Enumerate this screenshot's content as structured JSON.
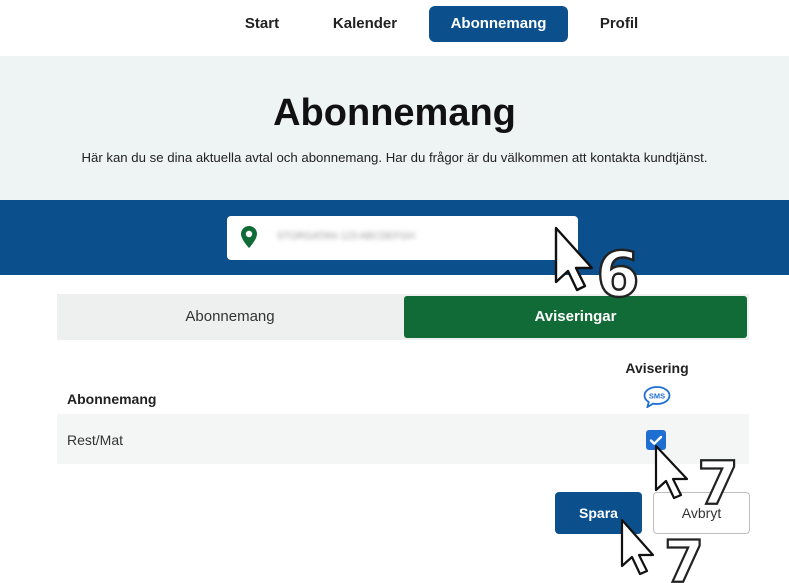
{
  "nav": {
    "items": [
      {
        "label": "Start"
      },
      {
        "label": "Kalender"
      },
      {
        "label": "Abonnemang"
      },
      {
        "label": "Profil"
      }
    ],
    "active": "Abonnemang"
  },
  "hero": {
    "title": "Abonnemang",
    "subtitle": "Här kan du se dina aktuella avtal och abonnemang. Har du frågor är du välkommen att kontakta kundtjänst."
  },
  "address": {
    "value_blurred": "STORGATAN 123 ABCDEFGH",
    "icon": "location-pin-icon"
  },
  "tabs": [
    {
      "label": "Abonnemang",
      "active": false
    },
    {
      "label": "Aviseringar",
      "active": true
    }
  ],
  "table": {
    "column_header": "Avisering",
    "column_icon": "sms-icon",
    "column_icon_text": "SMS",
    "row_header": "Abonnemang",
    "rows": [
      {
        "label": "Rest/Mat",
        "checked": true
      }
    ]
  },
  "actions": {
    "save_label": "Spara",
    "cancel_label": "Avbryt"
  },
  "annotations": {
    "step_a": "6",
    "step_b": "7",
    "step_c": "7"
  },
  "colors": {
    "primary_blue": "#0b4f8c",
    "active_green": "#116b37",
    "checkbox_blue": "#1f6fd2"
  }
}
